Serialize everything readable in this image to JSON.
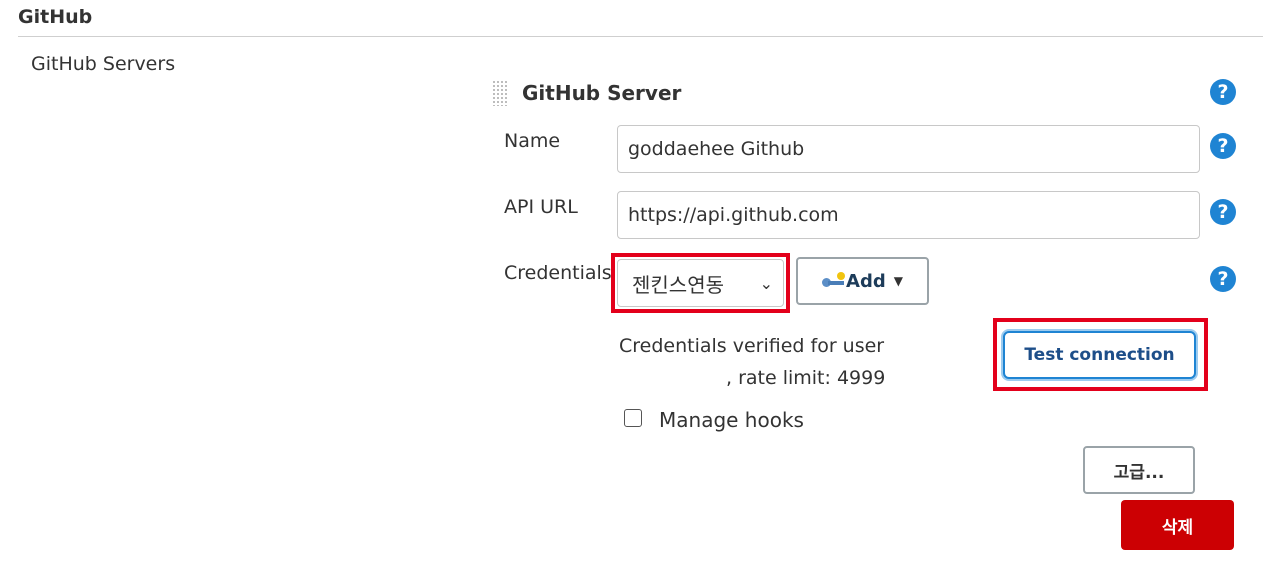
{
  "section": {
    "title": "GitHub"
  },
  "servers": {
    "label": "GitHub Servers"
  },
  "server": {
    "title": "GitHub Server",
    "help_glyph": "?",
    "name": {
      "label": "Name",
      "value": "goddaehee Github"
    },
    "api_url": {
      "label": "API URL",
      "value": "https://api.github.com"
    },
    "credentials": {
      "label": "Credentials",
      "selected": "젠킨스연동",
      "chevron": "⌄",
      "add_label": "Add",
      "add_caret": "▼",
      "verified_line1": "Credentials verified for user",
      "verified_line2": ", rate limit: 4999"
    },
    "test_connection_label": "Test connection",
    "manage_hooks": {
      "label": "Manage hooks",
      "checked": false
    },
    "advanced_label": "고급...",
    "delete_label": "삭제"
  },
  "colors": {
    "help_blue": "#1f84d3",
    "highlight_red": "#e3001b",
    "delete_red": "#cc0003"
  },
  "icons": [
    "help-icon",
    "drag-handle-icon",
    "key-icon",
    "chevron-down-icon",
    "caret-down-icon"
  ]
}
